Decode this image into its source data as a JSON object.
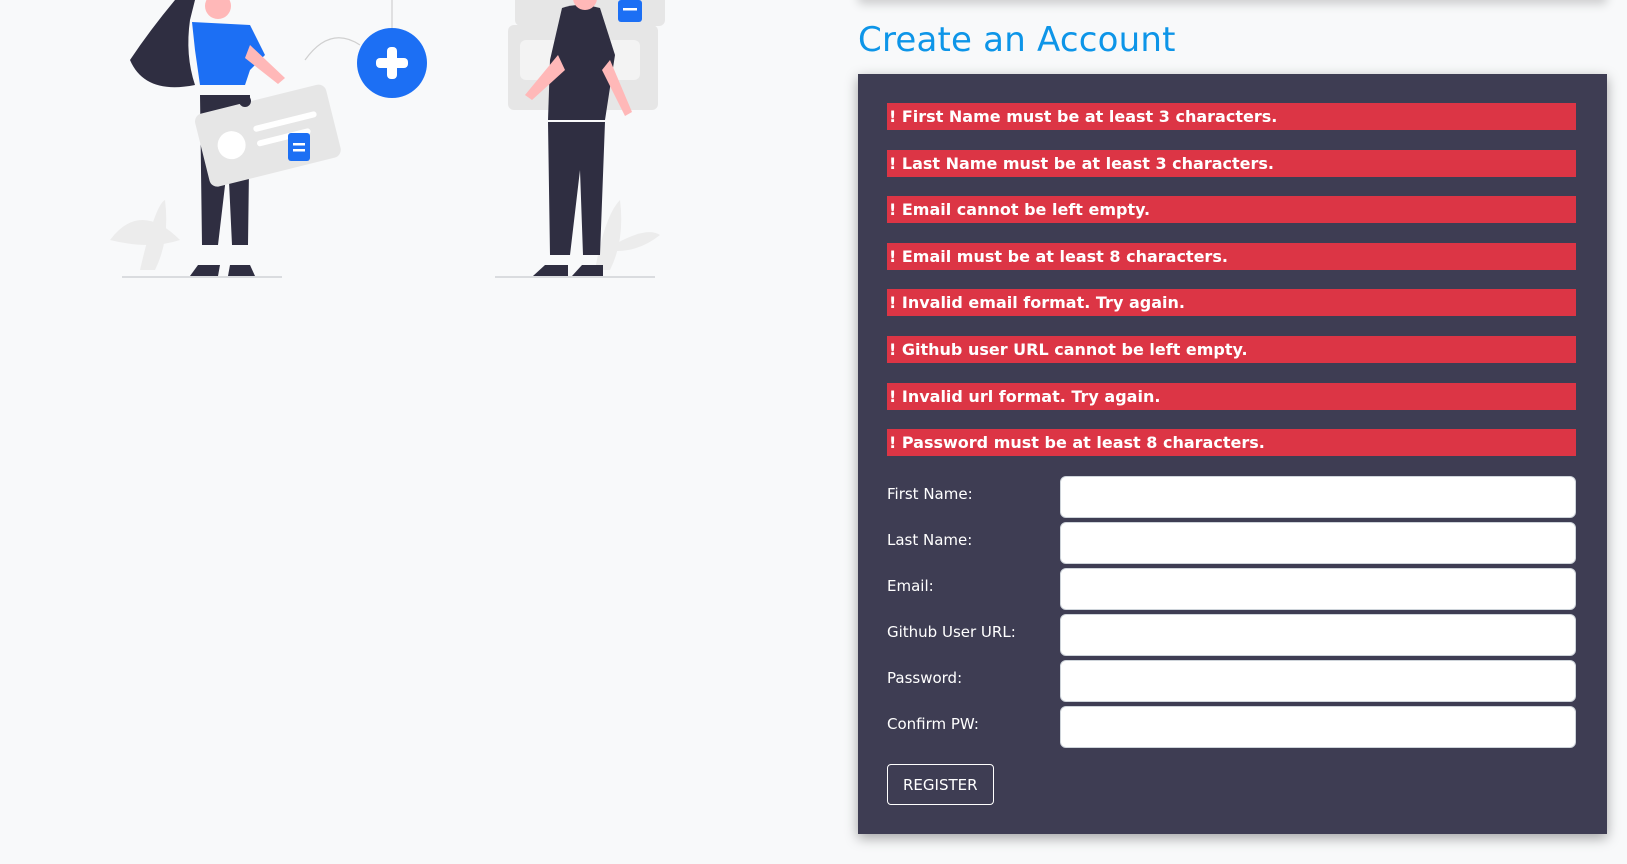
{
  "page": {
    "title": "Create an Account"
  },
  "errors": [
    "! First Name must be at least 3 characters.",
    "! Last Name must be at least 3 characters.",
    "! Email cannot be left empty.",
    "! Email must be at least 8 characters.",
    "! Invalid email format. Try again.",
    "! Github user URL cannot be left empty.",
    "! Invalid url format. Try again.",
    "! Password must be at least 8 characters."
  ],
  "form": {
    "fields": [
      {
        "label": "First Name:",
        "value": ""
      },
      {
        "label": "Last Name:",
        "value": ""
      },
      {
        "label": "Email:",
        "value": ""
      },
      {
        "label": "Github User URL:",
        "value": ""
      },
      {
        "label": "Password:",
        "value": ""
      },
      {
        "label": "Confirm PW:",
        "value": ""
      }
    ],
    "register_label": "REGISTER"
  },
  "colors": {
    "title": "#0d95e8",
    "panel_bg": "#3e3d53",
    "error_bg": "#dc3545",
    "accent_blue": "#1c6ff4",
    "page_bg": "#f8f9fa"
  }
}
